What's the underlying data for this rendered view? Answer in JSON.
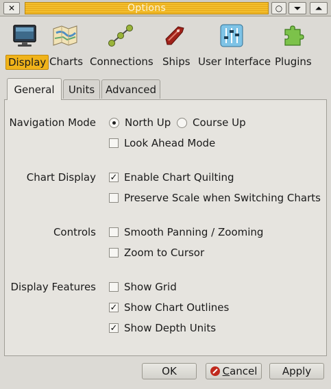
{
  "window": {
    "title": "Options",
    "close_glyph": "✕",
    "minimize_glyph": "○",
    "menu_glyph": "⏷",
    "shade_glyph": "⏶"
  },
  "categories": [
    {
      "label": "Display",
      "icon": "monitor-icon",
      "active": true
    },
    {
      "label": "Charts",
      "icon": "charts-icon",
      "active": false
    },
    {
      "label": "Connections",
      "icon": "connections-icon",
      "active": false
    },
    {
      "label": "Ships",
      "icon": "ship-icon",
      "active": false
    },
    {
      "label": "User Interface",
      "icon": "sliders-icon",
      "active": false
    },
    {
      "label": "Plugins",
      "icon": "puzzle-icon",
      "active": false
    }
  ],
  "tabs": [
    {
      "label": "General",
      "active": true
    },
    {
      "label": "Units",
      "active": false
    },
    {
      "label": "Advanced",
      "active": false
    }
  ],
  "groups": {
    "navigation_mode": {
      "label": "Navigation Mode",
      "north_up": {
        "label": "North Up",
        "selected": true
      },
      "course_up": {
        "label": "Course Up",
        "selected": false
      },
      "look_ahead": {
        "label": "Look Ahead Mode",
        "checked": false
      }
    },
    "chart_display": {
      "label": "Chart Display",
      "quilting": {
        "label": "Enable Chart Quilting",
        "checked": true
      },
      "preserve_scale": {
        "label": "Preserve Scale when Switching Charts",
        "checked": false
      }
    },
    "controls": {
      "label": "Controls",
      "smooth_panning": {
        "label": "Smooth Panning / Zooming",
        "checked": false
      },
      "zoom_cursor": {
        "label": "Zoom to Cursor",
        "checked": false
      }
    },
    "display_features": {
      "label": "Display Features",
      "show_grid": {
        "label": "Show Grid",
        "checked": false
      },
      "chart_outlines": {
        "label": "Show Chart Outlines",
        "checked": true
      },
      "depth_units": {
        "label": "Show Depth Units",
        "checked": true
      }
    }
  },
  "buttons": {
    "ok": "OK",
    "cancel_prefix": "",
    "cancel_mnemonic": "C",
    "cancel_rest": "ancel",
    "apply": "Apply"
  },
  "colors": {
    "title_accent": "#f3be2c",
    "active_category": "#f0b31a",
    "background": "#dcdad5"
  }
}
